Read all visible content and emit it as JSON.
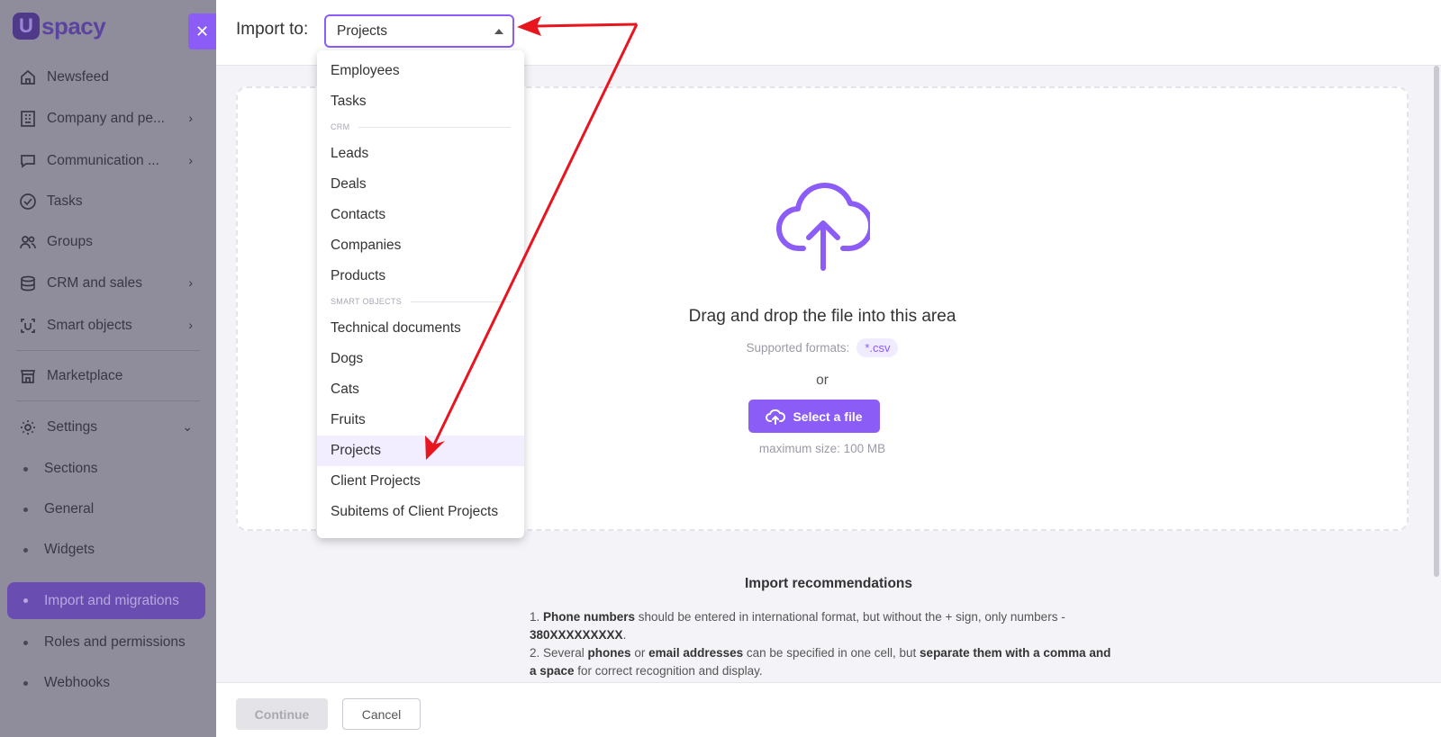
{
  "brand": {
    "logo_text": "spacy",
    "logo_letter": "U"
  },
  "sidebar": {
    "items": [
      {
        "label": "Newsfeed",
        "icon": "home-icon"
      },
      {
        "label": "Company and pe...",
        "icon": "building-icon",
        "has_chevron": true
      },
      {
        "label": "Communication ...",
        "icon": "chat-icon",
        "has_chevron": true
      },
      {
        "label": "Tasks",
        "icon": "check-circle-icon"
      },
      {
        "label": "Groups",
        "icon": "users-icon"
      },
      {
        "label": "CRM and sales",
        "icon": "database-icon",
        "has_chevron": true
      },
      {
        "label": "Smart objects",
        "icon": "smart-object-icon",
        "has_chevron": true
      },
      {
        "label": "Marketplace",
        "icon": "store-icon"
      },
      {
        "label": "Settings",
        "icon": "gear-icon",
        "expanded": true
      }
    ],
    "settings_sub": [
      {
        "label": "Sections"
      },
      {
        "label": "General"
      },
      {
        "label": "Widgets"
      },
      {
        "label": "Import and migrations",
        "active": true
      },
      {
        "label": "Roles and permissions"
      },
      {
        "label": "Webhooks"
      }
    ]
  },
  "header": {
    "import_label": "Import to:",
    "select_value": "Projects"
  },
  "dropdown": {
    "items_top": [
      "Employees",
      "Tasks"
    ],
    "group_crm": "CRM",
    "items_crm": [
      "Leads",
      "Deals",
      "Contacts",
      "Companies",
      "Products"
    ],
    "group_smart": "SMART OBJECTS",
    "items_smart": [
      "Technical documents",
      "Dogs",
      "Cats",
      "Fruits",
      "Projects",
      "Client Projects",
      "Subitems of Client Projects"
    ],
    "selected": "Projects"
  },
  "dropzone": {
    "title": "Drag and drop the file into this area",
    "formats_label": "Supported formats:",
    "format": "*.csv",
    "or": "or",
    "select_button": "Select a file",
    "max_size": "maximum size: 100 MB"
  },
  "recommendations": {
    "title": "Import recommendations",
    "line1_bold": "Phone numbers",
    "line1_rest": " should be entered in international format, but without the + sign, only numbers - ",
    "line1_bold2": "380XXXXXXXXX",
    "line2_pre": "2. Several ",
    "line2_b1": "phones",
    "line2_mid": " or ",
    "line2_b2": "email addresses",
    "line2_mid2": " can be specified in one cell, but ",
    "line2_b3": "separate them with a comma and a space",
    "line2_end": " for correct recognition and display."
  },
  "footer": {
    "continue": "Continue",
    "cancel": "Cancel"
  },
  "colors": {
    "accent": "#8b5cf6",
    "annotation": "#e8141e"
  }
}
